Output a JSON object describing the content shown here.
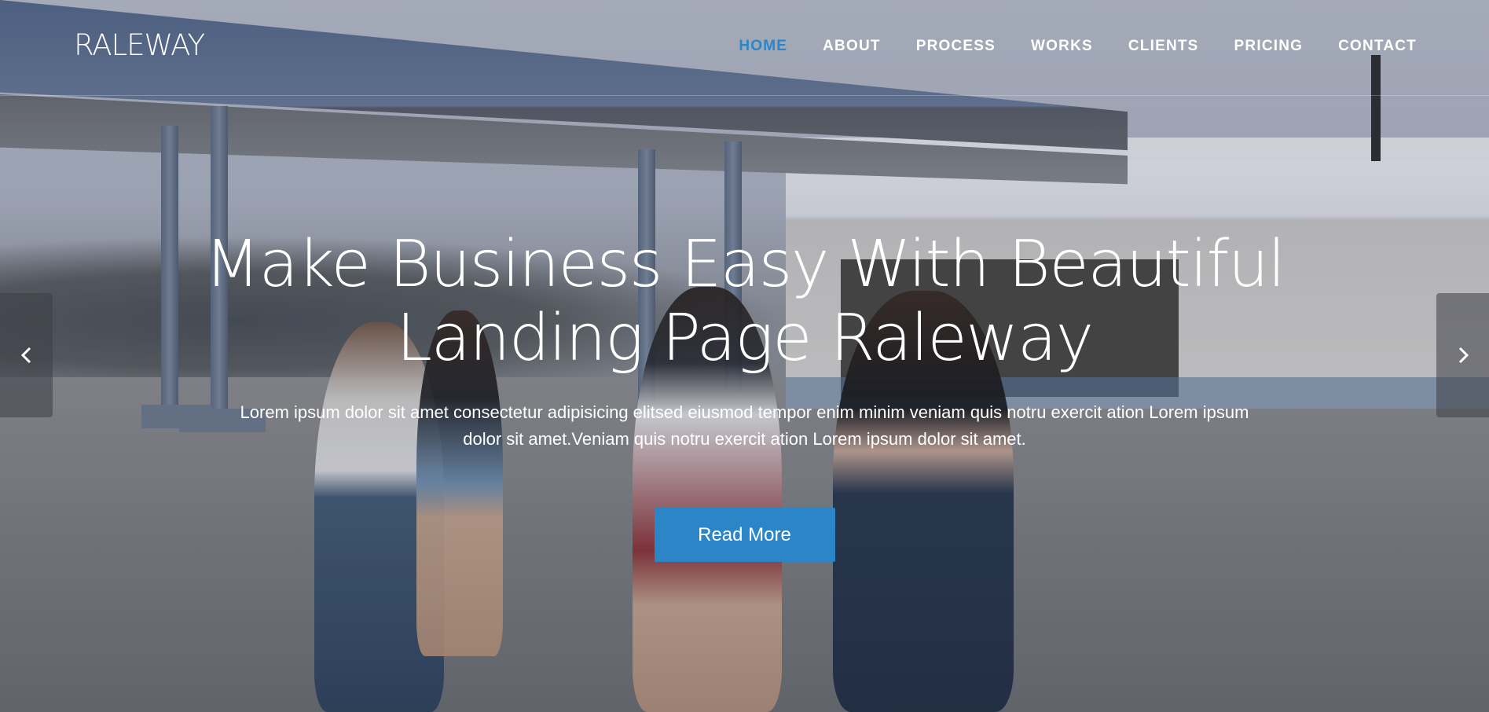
{
  "header": {
    "logo": "RALEWAY",
    "nav": [
      {
        "label": "HOME",
        "active": true
      },
      {
        "label": "ABOUT",
        "active": false
      },
      {
        "label": "PROCESS",
        "active": false
      },
      {
        "label": "WORKS",
        "active": false
      },
      {
        "label": "CLIENTS",
        "active": false
      },
      {
        "label": "PRICING",
        "active": false
      },
      {
        "label": "CONTACT",
        "active": false
      }
    ]
  },
  "hero": {
    "headline_line1": "Make Business Easy With Beautiful",
    "headline_line2": "Landing Page Raleway",
    "subtext": "Lorem ipsum dolor sit amet consectetur adipisicing elitsed eiusmod tempor enim minim veniam quis notru exercit ation Lorem ipsum dolor sit amet.Veniam quis notru exercit ation Lorem ipsum dolor sit amet.",
    "cta_label": "Read More"
  },
  "slider": {
    "prev_icon": "chevron-left-icon",
    "next_icon": "chevron-right-icon"
  },
  "colors": {
    "accent": "#2b85c7",
    "text_light": "#ffffff"
  }
}
